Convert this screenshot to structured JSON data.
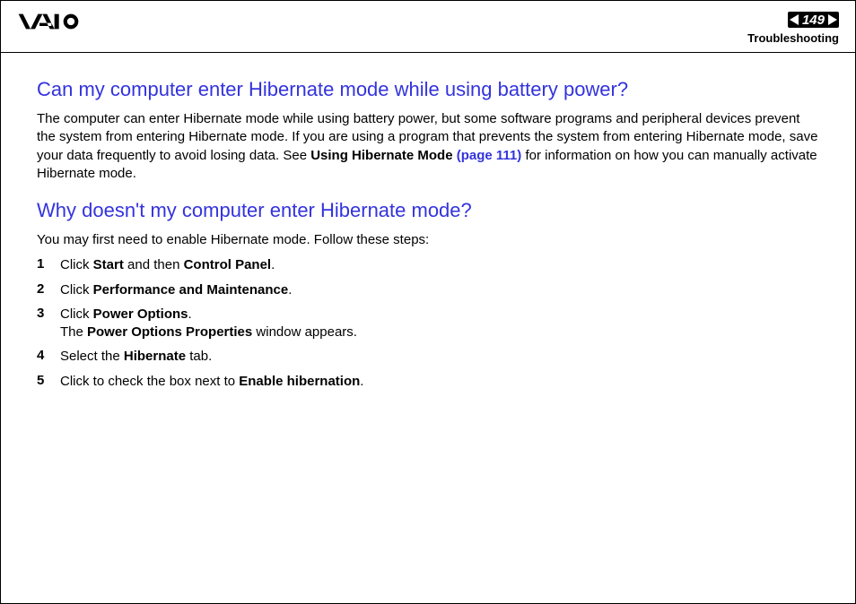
{
  "header": {
    "page_number": "149",
    "section": "Troubleshooting"
  },
  "q1": {
    "title": "Can my computer enter Hibernate mode while using battery power?",
    "para_before": "The computer can enter Hibernate mode while using battery power, but some software programs and peripheral devices prevent the system from entering Hibernate mode. If you are using a program that prevents the system from entering Hibernate mode, save your data frequently to avoid losing data. See ",
    "bold1": "Using Hibernate Mode",
    "link": " (page 111)",
    "para_after": " for information on how you can manually activate Hibernate mode."
  },
  "q2": {
    "title": "Why doesn't my computer enter Hibernate mode?",
    "intro": "You may first need to enable Hibernate mode. Follow these steps:",
    "steps": [
      {
        "n": "1",
        "pre": "Click ",
        "b1": "Start",
        "mid": " and then ",
        "b2": "Control Panel",
        "post": "."
      },
      {
        "n": "2",
        "pre": "Click ",
        "b1": "Performance and Maintenance",
        "post": "."
      },
      {
        "n": "3",
        "pre": "Click ",
        "b1": "Power Options",
        "post": ".",
        "line2_pre": "The ",
        "line2_b": "Power Options Properties",
        "line2_post": " window appears."
      },
      {
        "n": "4",
        "pre": "Select the ",
        "b1": "Hibernate",
        "post": " tab."
      },
      {
        "n": "5",
        "pre": "Click to check the box next to ",
        "b1": "Enable hibernation",
        "post": "."
      }
    ]
  }
}
